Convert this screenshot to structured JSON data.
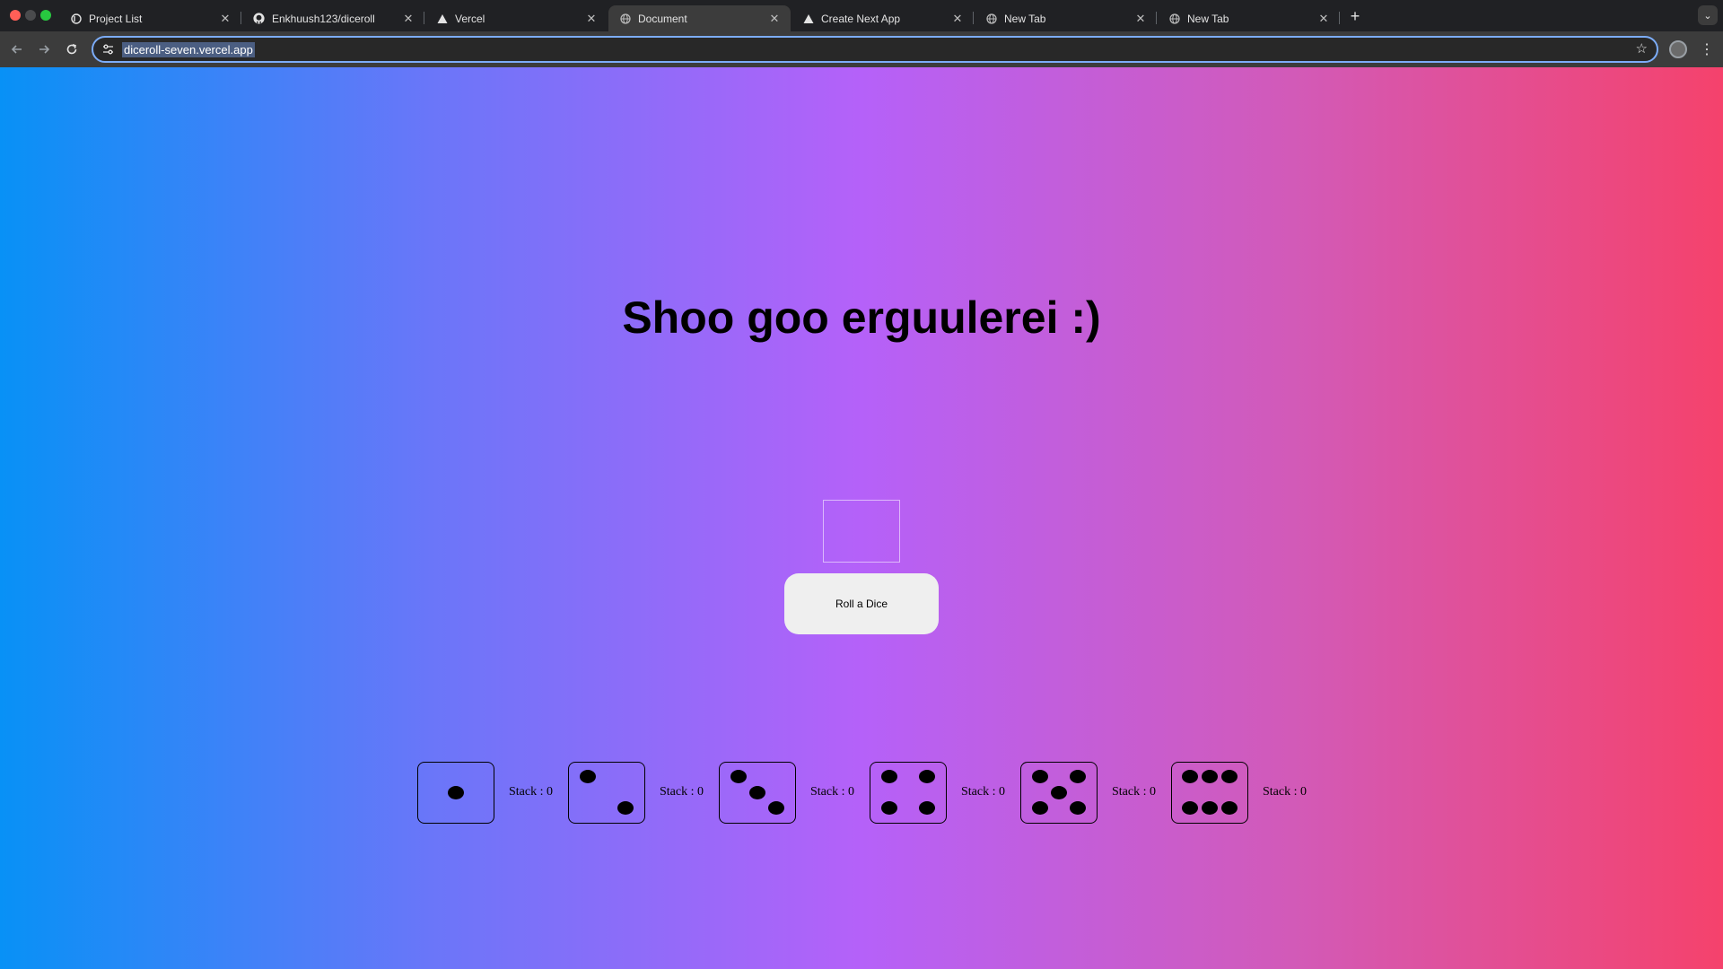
{
  "browser": {
    "tabs": [
      {
        "title": "Project List",
        "icon": "project-icon"
      },
      {
        "title": "Enkhuush123/diceroll",
        "icon": "github-icon"
      },
      {
        "title": "Vercel",
        "icon": "vercel-icon"
      },
      {
        "title": "Document",
        "icon": "globe-icon",
        "active": true
      },
      {
        "title": "Create Next App",
        "icon": "vercel-icon"
      },
      {
        "title": "New Tab",
        "icon": "globe-icon"
      },
      {
        "title": "New Tab",
        "icon": "globe-icon"
      }
    ],
    "address": "diceroll-seven.vercel.app"
  },
  "page": {
    "heading": "Shoo goo erguulerei :)",
    "roll_button": "Roll a Dice",
    "dice": [
      {
        "face": 1,
        "stack_label": "Stack : 0"
      },
      {
        "face": 2,
        "stack_label": "Stack : 0"
      },
      {
        "face": 3,
        "stack_label": "Stack : 0"
      },
      {
        "face": 4,
        "stack_label": "Stack : 0"
      },
      {
        "face": 5,
        "stack_label": "Stack : 0"
      },
      {
        "face": 6,
        "stack_label": "Stack : 0"
      }
    ]
  },
  "colors": {
    "gradient": [
      "#0891f6",
      "#6a76f9",
      "#b561f9",
      "#d25ab8",
      "#f5426c"
    ],
    "button_bg": "#efefef"
  }
}
